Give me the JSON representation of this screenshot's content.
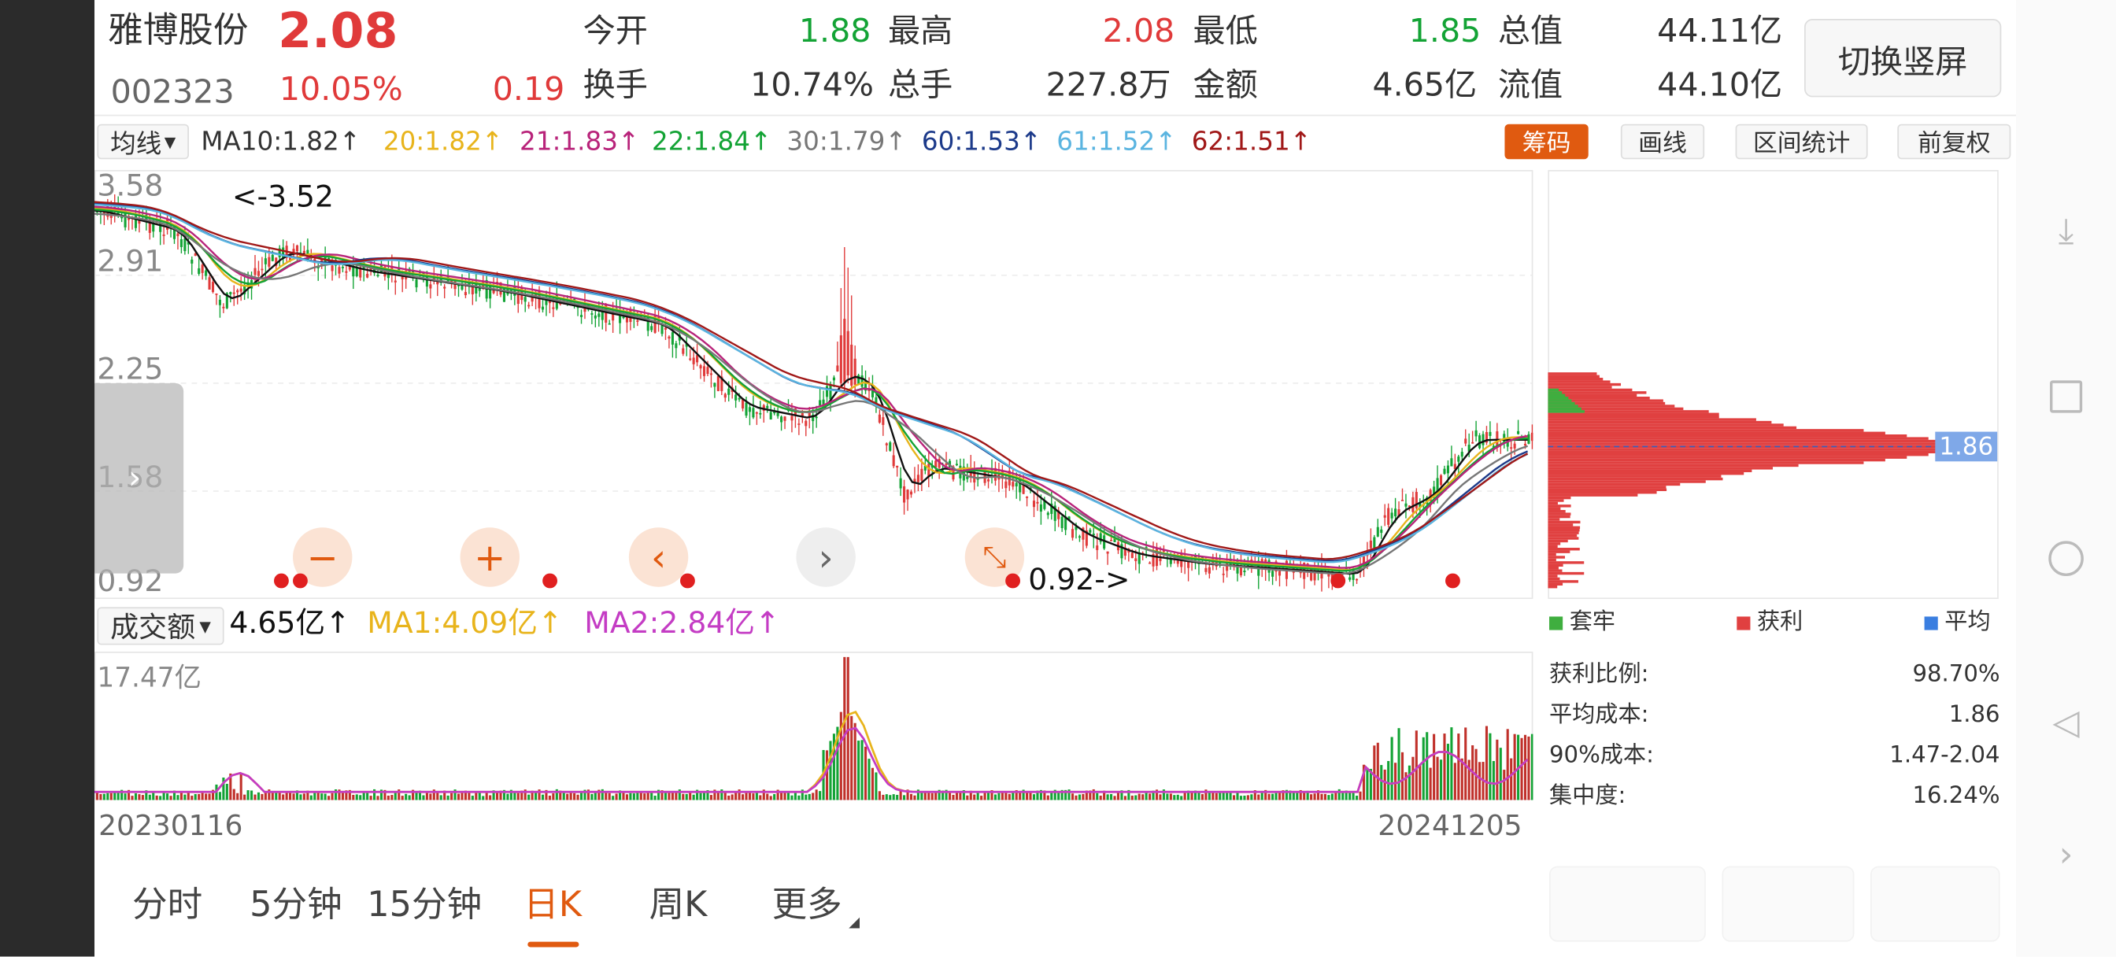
{
  "stock": {
    "name": "雅博股份",
    "price": "2.08",
    "code": "002323",
    "change_pct": "10.05%",
    "change": "0.19"
  },
  "quote": {
    "open_label": "今开",
    "open": "1.88",
    "high_label": "最高",
    "high": "2.08",
    "low_label": "最低",
    "low": "1.85",
    "mktcap_label": "总值",
    "mktcap": "44.11亿",
    "turnover_label": "换手",
    "turnover": "10.74%",
    "volume_label": "总手",
    "volume": "227.8万",
    "amount_label": "金额",
    "amount": "4.65亿",
    "float_label": "流值",
    "float": "44.10亿"
  },
  "toggle_button": "切换竖屏",
  "ma_bar": {
    "selector": "均线",
    "items": [
      {
        "text": "MA10:1.82↑",
        "color": "#333333"
      },
      {
        "text": "20:1.82↑",
        "color": "#e8b41c"
      },
      {
        "text": "21:1.83↑",
        "color": "#b8237a"
      },
      {
        "text": "22:1.84↑",
        "color": "#13a335"
      },
      {
        "text": "30:1.79↑",
        "color": "#777777"
      },
      {
        "text": "60:1.53↑",
        "color": "#1c3a8a"
      },
      {
        "text": "61:1.52↑",
        "color": "#5ab4e0"
      },
      {
        "text": "62:1.51↑",
        "color": "#a01818"
      }
    ],
    "chips_button": "筹码",
    "draw_button": "画线",
    "range_button": "区间统计",
    "adjust_button": "前复权"
  },
  "price_axis": [
    "3.58",
    "2.91",
    "2.25",
    "1.58",
    "0.92"
  ],
  "price_high_marker": "<-3.52",
  "price_low_marker": "0.92->",
  "chip_price_label": "1.86",
  "chip_legend": {
    "trapped": "套牢",
    "profit": "获利",
    "average": "平均"
  },
  "chip_stats": [
    {
      "label": "获利比例:",
      "value": "98.70%"
    },
    {
      "label": "平均成本:",
      "value": "1.86"
    },
    {
      "label": "90%成本:",
      "value": "1.47-2.04"
    },
    {
      "label": "集中度:",
      "value": "16.24%"
    }
  ],
  "volume_bar": {
    "selector": "成交额",
    "value": "4.65亿↑",
    "ma1": "MA1:4.09亿↑",
    "ma2": "MA2:2.84亿↑",
    "axis_max": "17.47亿"
  },
  "date_start": "20230116",
  "date_end": "20241205",
  "tabs": [
    {
      "label": "分时",
      "active": false
    },
    {
      "label": "5分钟",
      "active": false
    },
    {
      "label": "15分钟",
      "active": false
    },
    {
      "label": "日K",
      "active": true
    },
    {
      "label": "周K",
      "active": false
    },
    {
      "label": "更多",
      "active": false
    }
  ],
  "colors": {
    "up": "#e03a3a",
    "down": "#13a335",
    "accent": "#e05a10"
  }
}
